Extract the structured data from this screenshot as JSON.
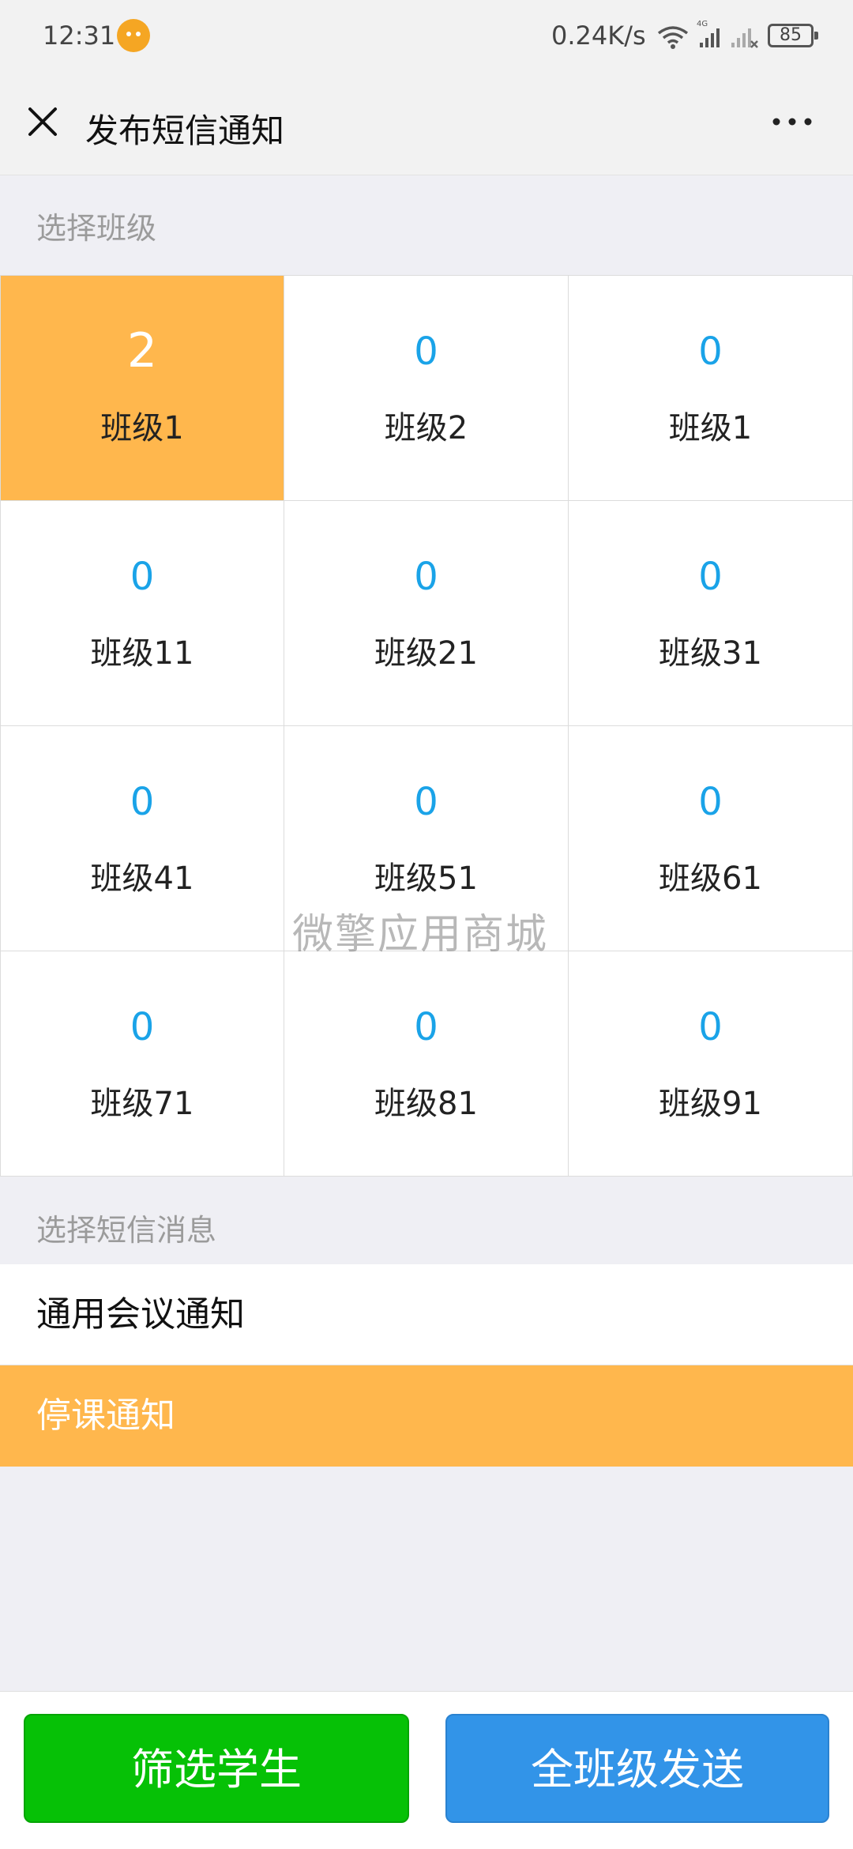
{
  "status_bar": {
    "time": "12:31",
    "net_speed": "0.24K/s",
    "network": "4G",
    "battery": "85"
  },
  "title_bar": {
    "title": "发布短信通知"
  },
  "class_section": {
    "label": "选择班级",
    "classes": [
      {
        "count": "2",
        "name": "班级1",
        "selected": true
      },
      {
        "count": "0",
        "name": "班级2",
        "selected": false
      },
      {
        "count": "0",
        "name": "班级1",
        "selected": false
      },
      {
        "count": "0",
        "name": "班级11",
        "selected": false
      },
      {
        "count": "0",
        "name": "班级21",
        "selected": false
      },
      {
        "count": "0",
        "name": "班级31",
        "selected": false
      },
      {
        "count": "0",
        "name": "班级41",
        "selected": false
      },
      {
        "count": "0",
        "name": "班级51",
        "selected": false
      },
      {
        "count": "0",
        "name": "班级61",
        "selected": false
      },
      {
        "count": "0",
        "name": "班级71",
        "selected": false
      },
      {
        "count": "0",
        "name": "班级81",
        "selected": false
      },
      {
        "count": "0",
        "name": "班级91",
        "selected": false
      }
    ]
  },
  "watermark": "微擎应用商城",
  "message_section": {
    "label": "选择短信消息",
    "messages": [
      {
        "title": "通用会议通知",
        "selected": false
      },
      {
        "title": "停课通知",
        "selected": true
      }
    ]
  },
  "actions": {
    "filter_label": "筛选学生",
    "send_all_label": "全班级发送"
  },
  "colors": {
    "selected": "#ffb74d",
    "count_blue": "#1aa3e8",
    "filter_button": "#06c106",
    "send_button": "#3294e8"
  }
}
